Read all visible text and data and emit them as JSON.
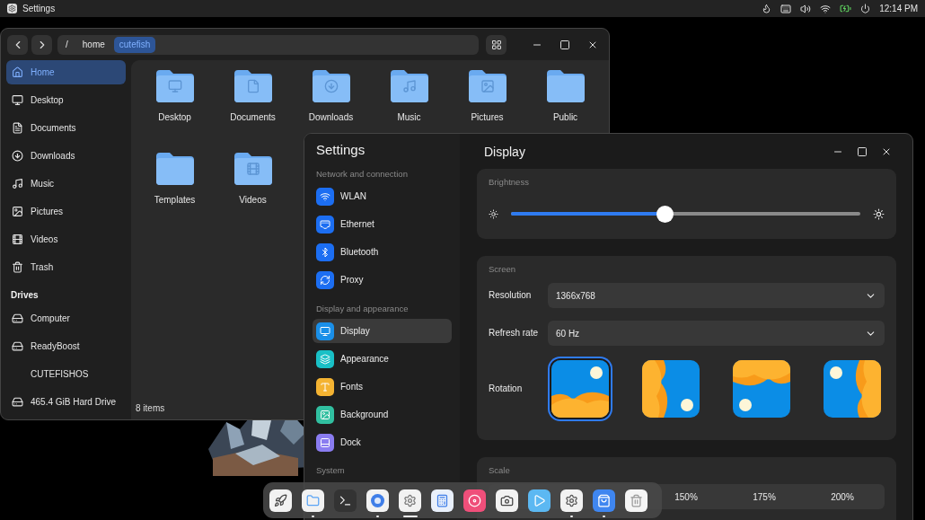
{
  "top_bar": {
    "app_title": "Settings",
    "clock": "12:14 PM"
  },
  "file_manager": {
    "path": [
      {
        "label": "/",
        "selected": false
      },
      {
        "label": "home",
        "selected": false
      },
      {
        "label": "cutefish",
        "selected": true
      }
    ],
    "places": [
      {
        "label": "Home",
        "selected": true
      },
      {
        "label": "Desktop",
        "selected": false
      },
      {
        "label": "Documents",
        "selected": false
      },
      {
        "label": "Downloads",
        "selected": false
      },
      {
        "label": "Music",
        "selected": false
      },
      {
        "label": "Pictures",
        "selected": false
      },
      {
        "label": "Videos",
        "selected": false
      },
      {
        "label": "Trash",
        "selected": false
      }
    ],
    "drives_heading": "Drives",
    "drives": [
      {
        "label": "Computer",
        "selected": false
      },
      {
        "label": "ReadyBoost",
        "selected": false
      },
      {
        "label": "CUTEFISHOS",
        "selected": false
      },
      {
        "label": "465.4 GiB Hard Drive",
        "selected": false
      }
    ],
    "folders": [
      "Desktop",
      "Documents",
      "Downloads",
      "Music",
      "Pictures",
      "Public",
      "Templates",
      "Videos"
    ],
    "status": "8 items"
  },
  "settings": {
    "title": "Settings",
    "groups": [
      {
        "heading": "Network and connection",
        "items": [
          {
            "label": "WLAN",
            "selected": false
          },
          {
            "label": "Ethernet",
            "selected": false
          },
          {
            "label": "Bluetooth",
            "selected": false
          },
          {
            "label": "Proxy",
            "selected": false
          }
        ]
      },
      {
        "heading": "Display and appearance",
        "items": [
          {
            "label": "Display",
            "selected": true
          },
          {
            "label": "Appearance",
            "selected": false
          },
          {
            "label": "Fonts",
            "selected": false
          },
          {
            "label": "Background",
            "selected": false
          },
          {
            "label": "Dock",
            "selected": false
          }
        ]
      },
      {
        "heading": "System"
      }
    ],
    "page_title": "Display",
    "brightness": {
      "label": "Brightness",
      "level": 0.44
    },
    "screen": {
      "heading": "Screen",
      "rows": [
        {
          "label": "Resolution",
          "value": "1366x768"
        },
        {
          "label": "Refresh rate",
          "value": "60 Hz"
        }
      ],
      "rotation": {
        "label": "Rotation",
        "options": [
          {
            "selected": true
          },
          {
            "selected": false
          },
          {
            "selected": false
          },
          {
            "selected": false
          }
        ]
      }
    },
    "scale": {
      "heading": "Scale",
      "options": [
        {
          "label": "150%",
          "selected": false
        },
        {
          "label": "175%",
          "selected": false
        },
        {
          "label": "200%",
          "selected": false
        }
      ]
    }
  },
  "dock": {
    "items": [
      {
        "running": false,
        "focused": false
      },
      {
        "running": true,
        "focused": false
      },
      {
        "running": false,
        "focused": false
      },
      {
        "running": true,
        "focused": false
      },
      {
        "running": true,
        "focused": true
      },
      {
        "running": false,
        "focused": false
      },
      {
        "running": false,
        "focused": false
      },
      {
        "running": false,
        "focused": false
      },
      {
        "running": false,
        "focused": false
      },
      {
        "running": true,
        "focused": false
      },
      {
        "running": true,
        "focused": false
      },
      {
        "running": false,
        "focused": false
      }
    ]
  }
}
